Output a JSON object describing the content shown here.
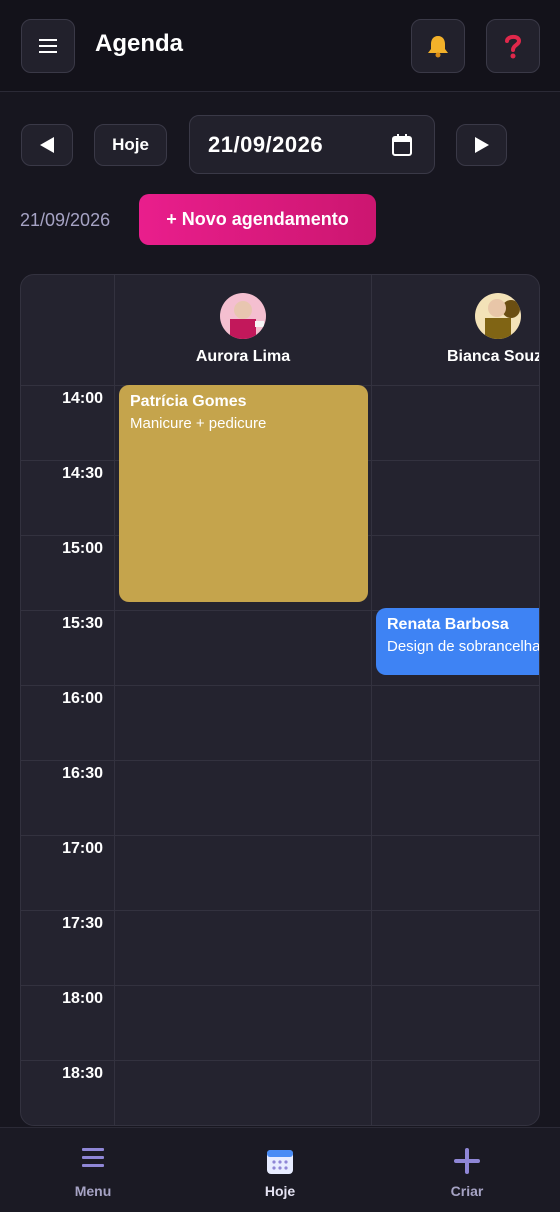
{
  "header": {
    "title": "Agenda",
    "menu_icon": "hamburger-icon",
    "bell_icon": "bell-icon",
    "help_icon": "question-icon"
  },
  "controls": {
    "today_label": "Hoje",
    "date_value": "21/09/2026",
    "selected_date": "21/09/2026",
    "new_appointment_label": "+ Novo agendamento"
  },
  "staff": [
    {
      "name": "Aurora Lima"
    },
    {
      "name": "Bianca Souz"
    }
  ],
  "times": [
    "14:00",
    "14:30",
    "15:00",
    "15:30",
    "16:00",
    "16:30",
    "17:00",
    "17:30",
    "18:00",
    "18:30"
  ],
  "events": [
    {
      "client": "Patrícia Gomes",
      "service": "Manicure + pedicure",
      "color": "#c5a44c"
    },
    {
      "client": "Renata Barbosa",
      "service": "Design de sobrancelha",
      "color": "#3e83f4"
    }
  ],
  "bottom_nav": {
    "menu_label": "Menu",
    "today_label": "Hoje",
    "create_label": "Criar"
  },
  "colors": {
    "accent": "#e91e8c",
    "nav_icon": "#8f86d6"
  }
}
